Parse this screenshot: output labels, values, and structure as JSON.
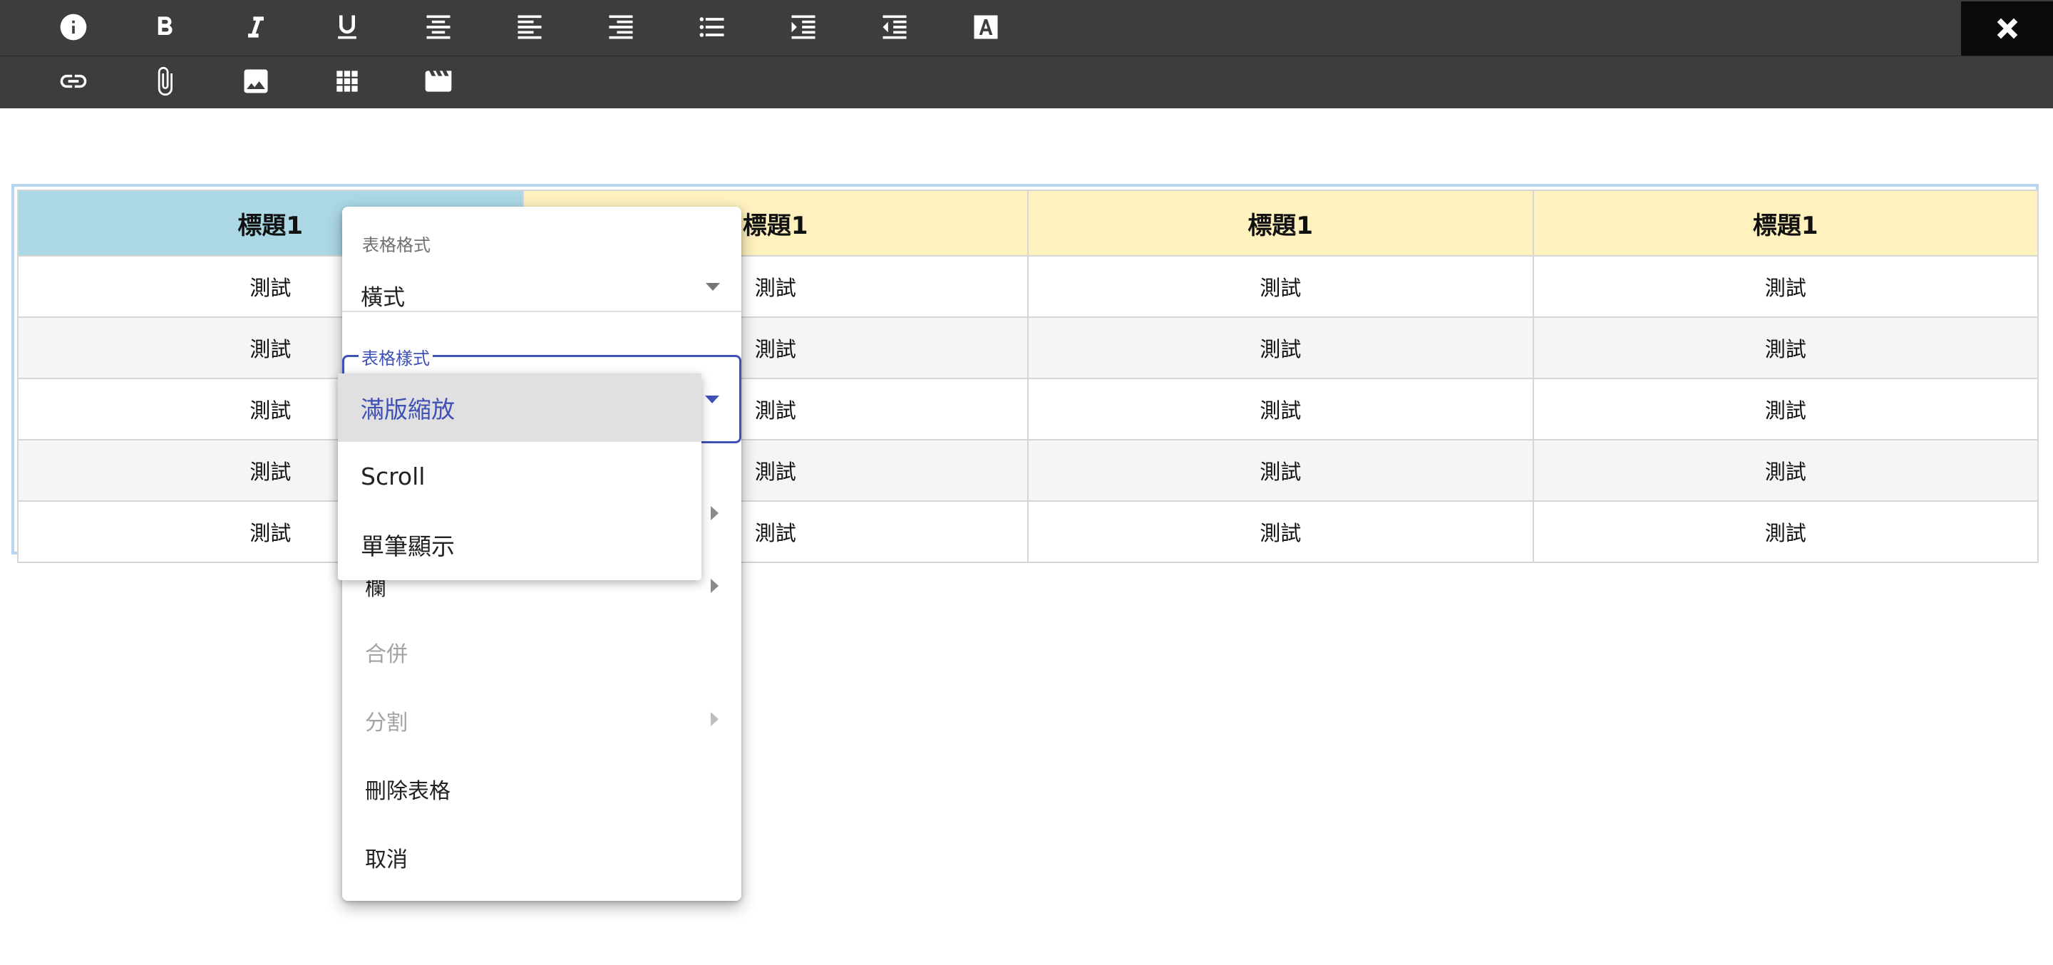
{
  "toolbar": {
    "row1": [
      {
        "icon": "info-icon"
      },
      {
        "icon": "bold-icon"
      },
      {
        "icon": "italic-icon"
      },
      {
        "icon": "underline-icon"
      },
      {
        "icon": "align-center-icon"
      },
      {
        "icon": "align-left-icon"
      },
      {
        "icon": "align-right-icon"
      },
      {
        "icon": "bulleted-list-icon"
      },
      {
        "icon": "indent-increase-icon"
      },
      {
        "icon": "indent-decrease-icon"
      },
      {
        "icon": "font-color-icon",
        "label": "A"
      }
    ],
    "row2": [
      {
        "icon": "link-icon"
      },
      {
        "icon": "attach-icon"
      },
      {
        "icon": "image-icon"
      },
      {
        "icon": "table-icon"
      },
      {
        "icon": "video-icon"
      }
    ],
    "close_icon": "close-icon"
  },
  "table": {
    "headers": [
      "標題1",
      "標題1",
      "標題1",
      "標題1"
    ],
    "rows": [
      [
        "測試",
        "測試",
        "測試",
        "測試"
      ],
      [
        "測試",
        "測試",
        "測試",
        "測試"
      ],
      [
        "測試",
        "測試",
        "測試",
        "測試"
      ],
      [
        "測試",
        "測試",
        "測試",
        "測試"
      ],
      [
        "測試",
        "測試",
        "測試",
        "測試"
      ]
    ],
    "colors": {
      "first_header": "#acd8e6",
      "header": "#fff2bf",
      "stripe": "#f5f5f5",
      "border": "#b9d6f0"
    }
  },
  "context_menu": {
    "format_field": {
      "label": "表格格式",
      "value": "橫式"
    },
    "style_field": {
      "label": "表格樣式"
    },
    "items": [
      {
        "label": "欄",
        "disabled": false,
        "submenu": true
      },
      {
        "label": "合併",
        "disabled": true,
        "submenu": false
      },
      {
        "label": "分割",
        "disabled": true,
        "submenu": true
      },
      {
        "label": "刪除表格",
        "disabled": false,
        "submenu": false
      },
      {
        "label": "取消",
        "disabled": false,
        "submenu": false
      }
    ]
  },
  "style_dropdown": {
    "options": [
      "滿版縮放",
      "Scroll",
      "單筆顯示"
    ],
    "selected": "滿版縮放",
    "accent": "#3f51b5"
  }
}
